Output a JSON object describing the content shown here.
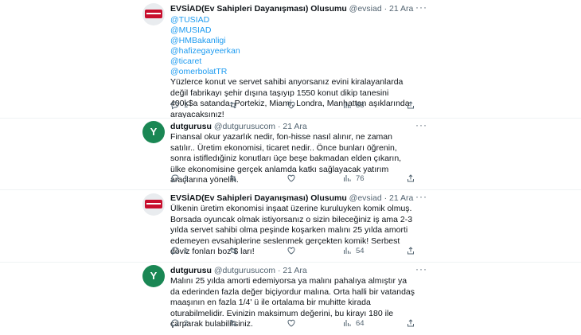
{
  "tweets": [
    {
      "name": "EVSİAD(Ev Sahipleri Dayanışması) Olusumu",
      "handle": "@evsiad",
      "dot": "·",
      "date": "21 Ara",
      "mentions": [
        "@TUSIAD",
        "@MUSIAD",
        "@HMBakanligi",
        "@hafizegayeerkan",
        "@ticaret",
        "@omerbolatTR"
      ],
      "text": "Yüzlerce konut ve servet sahibi anyorsanız evini kiralayanlarda değil fabrikayı şehir dışına taşıyıp 1550 konut dikip tanesini 400k$a satanda, Portekiz, Miami, Londra, Manhattan aşıklarında arayacaksınız!",
      "replies": "1",
      "retweets": "",
      "likes": "",
      "views": "58"
    },
    {
      "name": "dutgurusu",
      "handle": "@dutgurusucom",
      "dot": "·",
      "date": "21 Ara",
      "avatar_letter": "Y",
      "text": "Finansal okur yazarlık nedir, fon-hisse nasıl alınır, ne zaman satılır.. Üretim ekonomisi, ticaret nedir.. Önce bunları öğrenin, sonra istifledığiniz konutları üçe beşe bakmadan elden çıkarın, ülke ekonomisine gerçek anlamda katkı sağlayacak yatırım araçlarına yönelin.",
      "replies": "1",
      "retweets": "",
      "likes": "",
      "views": "76"
    },
    {
      "name": "EVSİAD(Ev Sahipleri Dayanışması) Olusumu",
      "handle": "@evsiad",
      "dot": "·",
      "date": "21 Ara",
      "text": "Ülkenin üretim ekonomisi inşaat üzerine kuruluyken komik olmuş. Borsada oyuncak olmak istiyorsanız o sizin bileceğiniz iş ama 2-3 yılda servet sahibi olma peşinde koşarken malını 25 yılda amorti edemeyen evsahiplerine seslenmek gerçekten komik! Serbest döviz fonları boz $ ları!",
      "replies": "1",
      "retweets": "",
      "likes": "",
      "views": "54"
    },
    {
      "name": "dutgurusu",
      "handle": "@dutgurusucom",
      "dot": "·",
      "date": "21 Ara",
      "avatar_letter": "Y",
      "text": "Malını 25 yılda amorti edemiyorsa ya  malını pahalıya almıştır ya da ederinden fazla değer biçiyordur malına. Orta halli bir vatandaş maaşının en fazla 1/4' ü ile ortalama bir muhitte kirada oturabilmelidir. Evinizin maksimum değerini, bu kirayı 180 ile çarparak bulabilirsiniz.",
      "replies": "2",
      "retweets": "",
      "likes": "",
      "views": "64"
    }
  ],
  "icons": {
    "more": "more-icon",
    "reply": "reply-icon",
    "retweet": "retweet-icon",
    "like": "heart-icon",
    "views": "views-icon",
    "share": "share-icon"
  },
  "colors": {
    "link": "#1d9bf0",
    "muted": "#536471",
    "text": "#0f1419"
  }
}
